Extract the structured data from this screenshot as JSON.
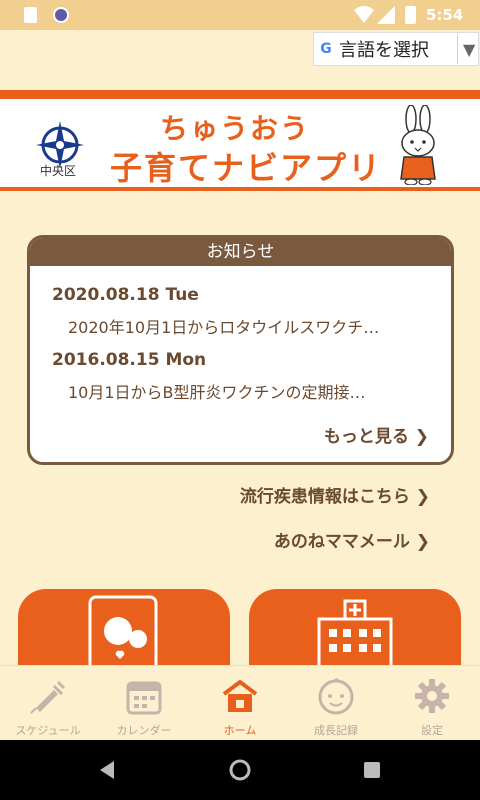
{
  "status": {
    "time": "5:54"
  },
  "translate": {
    "label": "言語を選択",
    "g": "G"
  },
  "header": {
    "title_line1": "ちゅうおう",
    "title_line2": "子育てナビアプリ",
    "ward_name": "中央区"
  },
  "news": {
    "heading": "お知らせ",
    "items": [
      {
        "date": "2020.08.18 Tue",
        "text": "2020年10月1日からロタウイルスワクチ…"
      },
      {
        "date": "2016.08.15 Mon",
        "text": "10月1日からB型肝炎ワクチンの定期接…"
      }
    ],
    "more": "もっと見る"
  },
  "links": {
    "epidemic": "流行疾患情報はこちら",
    "anone": "あのねママメール"
  },
  "nav": [
    {
      "label": "スケジュール",
      "icon": "syringe-icon"
    },
    {
      "label": "カレンダー",
      "icon": "calendar-icon"
    },
    {
      "label": "ホーム",
      "icon": "home-icon"
    },
    {
      "label": "成長記録",
      "icon": "baby-face-icon"
    },
    {
      "label": "設定",
      "icon": "gear-icon"
    }
  ],
  "colors": {
    "accent": "#e8601c",
    "brown": "#7a5a3e",
    "background": "#fdf0cf"
  }
}
